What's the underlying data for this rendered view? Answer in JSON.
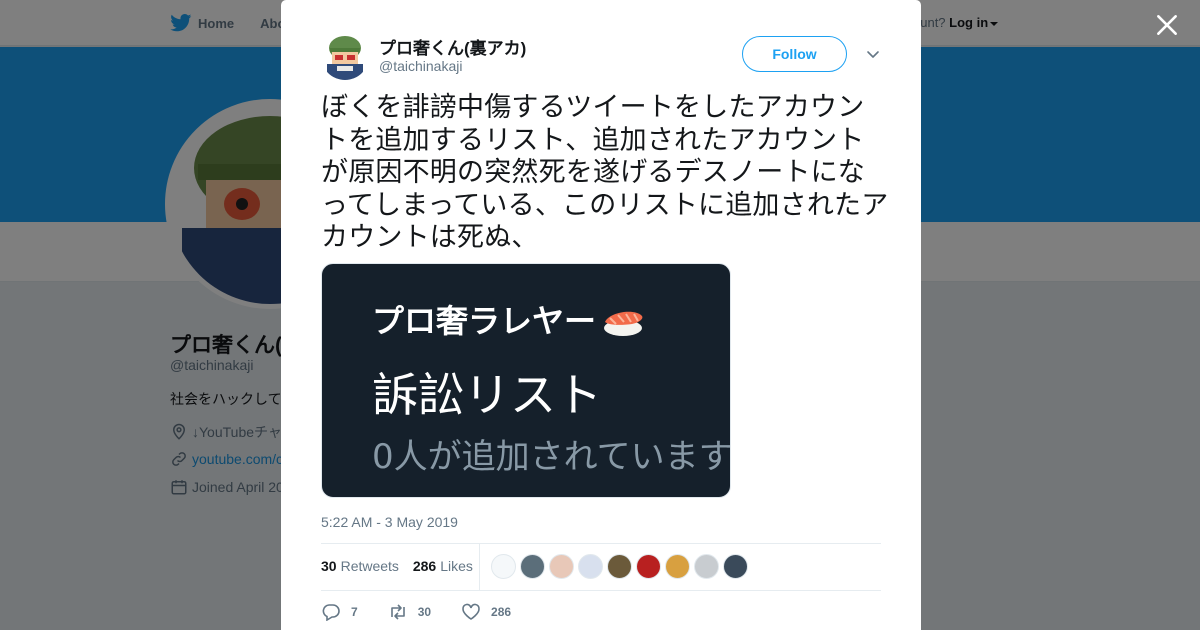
{
  "nav": {
    "home": "Home",
    "about": "Abo",
    "account_prompt": "ccount?",
    "login": "Log in"
  },
  "profile": {
    "name": "プロ奢くん(",
    "handle": "@taichinakaji",
    "bio": "社会をハックして",
    "location": "↓YouTubeチャ",
    "link": "youtube.com/c",
    "joined": "Joined April 20"
  },
  "tweet": {
    "author_name": "プロ奢くん(裏アカ)",
    "author_handle": "@taichinakaji",
    "follow_label": "Follow",
    "text": "ぼくを誹謗中傷するツイートをしたアカウントを追加するリスト、追加されたアカウントが原因不明の突然死を遂げるデスノートになってしまっている、このリストに追加されたアカウントは死ぬ、",
    "media": {
      "title": "プロ奢ラレヤー",
      "list_name": "訴訟リスト",
      "member_count": "0人が追加されています"
    },
    "timestamp": "5:22 AM - 3 May 2019",
    "retweets_count": "30",
    "retweets_label": "Retweets",
    "likes_count": "286",
    "likes_label": "Likes",
    "likers_colors": [
      "#f5f8fa",
      "#5b6e7a",
      "#e8c8b8",
      "#d8e0ee",
      "#6b5a3a",
      "#b82020",
      "#d8a040",
      "#c8ccd0",
      "#3a4a5a"
    ],
    "actions": {
      "reply": "7",
      "retweet": "30",
      "like": "286"
    }
  },
  "colors": {
    "accent": "#1da1f2",
    "media_bg": "#15202b"
  }
}
